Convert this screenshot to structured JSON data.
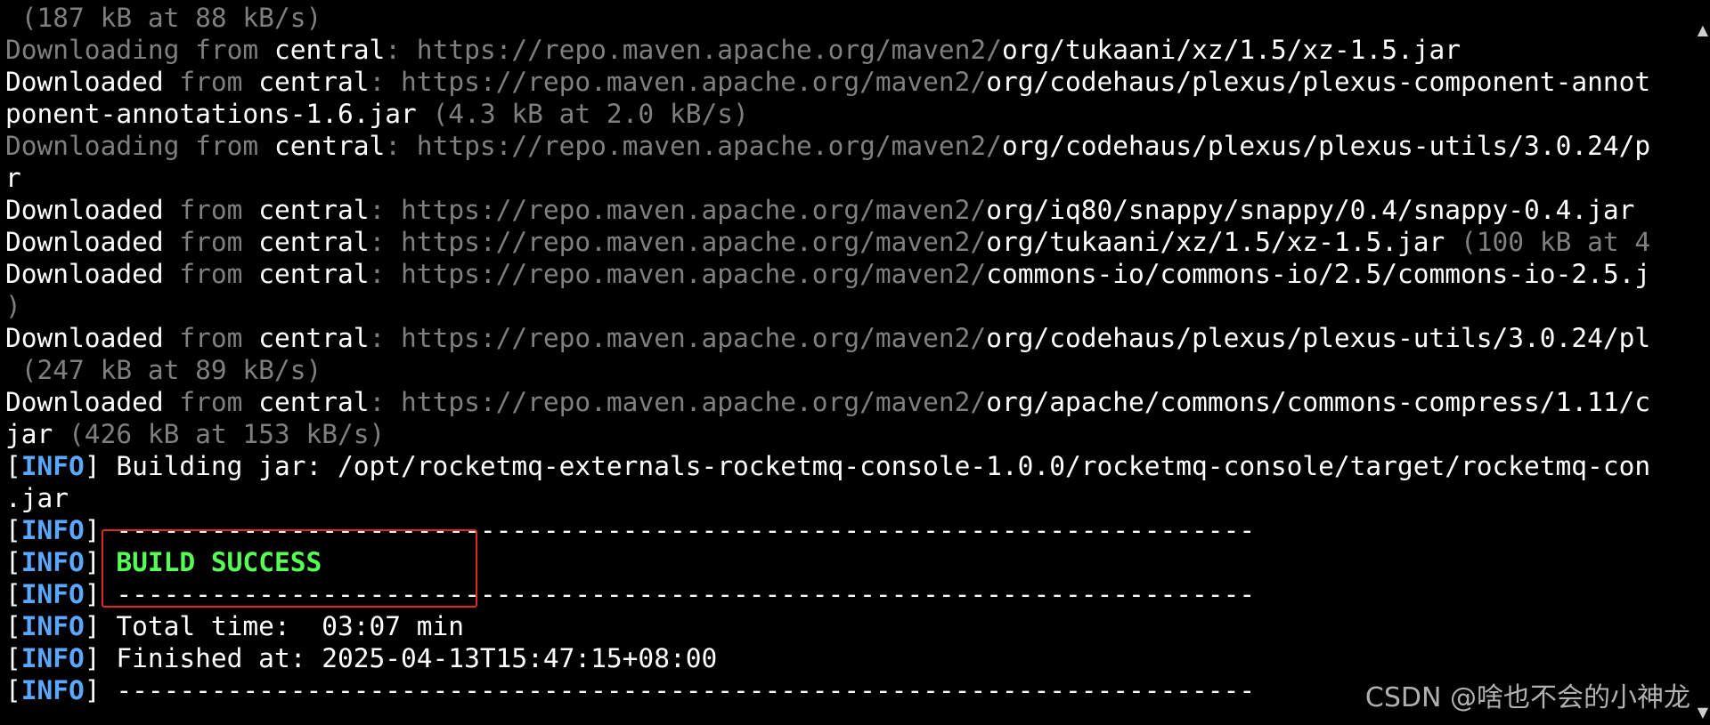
{
  "terminal": {
    "lines": [
      {
        "id": "l01",
        "parts": [
          {
            "t": " (187 kB at 88 kB/s)",
            "c": "dim"
          }
        ]
      },
      {
        "id": "l02",
        "parts": [
          {
            "t": "Downloading ",
            "c": "dim"
          },
          {
            "t": "from ",
            "c": "dim"
          },
          {
            "t": "central",
            "c": "bright"
          },
          {
            "t": ": https://repo.maven.apache.org/maven2/",
            "c": "dim"
          },
          {
            "t": "org/tukaani/xz/1.5/xz-1.5.jar",
            "c": "bright"
          }
        ]
      },
      {
        "id": "l03",
        "parts": [
          {
            "t": "Downloaded ",
            "c": "bright"
          },
          {
            "t": "from ",
            "c": "dim"
          },
          {
            "t": "central",
            "c": "bright"
          },
          {
            "t": ": https://repo.maven.apache.org/maven2/",
            "c": "dim"
          },
          {
            "t": "org/codehaus/plexus/plexus-component-annot",
            "c": "bright"
          }
        ]
      },
      {
        "id": "l04",
        "parts": [
          {
            "t": "ponent-annotations-1.6.jar ",
            "c": "bright"
          },
          {
            "t": "(4.3 kB at 2.0 kB/s)",
            "c": "dim"
          }
        ]
      },
      {
        "id": "l05",
        "parts": [
          {
            "t": "Downloading ",
            "c": "dim"
          },
          {
            "t": "from ",
            "c": "dim"
          },
          {
            "t": "central",
            "c": "bright"
          },
          {
            "t": ": https://repo.maven.apache.org/maven2/",
            "c": "dim"
          },
          {
            "t": "org/codehaus/plexus/plexus-utils/3.0.24/p",
            "c": "bright"
          }
        ]
      },
      {
        "id": "l06",
        "parts": [
          {
            "t": "r",
            "c": "bright"
          }
        ]
      },
      {
        "id": "l07",
        "parts": [
          {
            "t": "Downloaded ",
            "c": "bright"
          },
          {
            "t": "from ",
            "c": "dim"
          },
          {
            "t": "central",
            "c": "bright"
          },
          {
            "t": ": https://repo.maven.apache.org/maven2/",
            "c": "dim"
          },
          {
            "t": "org/iq80/snappy/snappy/0.4/snappy-0.4.jar",
            "c": "bright"
          }
        ]
      },
      {
        "id": "l08",
        "parts": [
          {
            "t": "Downloaded ",
            "c": "bright"
          },
          {
            "t": "from ",
            "c": "dim"
          },
          {
            "t": "central",
            "c": "bright"
          },
          {
            "t": ": https://repo.maven.apache.org/maven2/",
            "c": "dim"
          },
          {
            "t": "org/tukaani/xz/1.5/xz-1.5.jar ",
            "c": "bright"
          },
          {
            "t": "(100 kB at 4",
            "c": "dim"
          }
        ]
      },
      {
        "id": "l09",
        "parts": [
          {
            "t": "Downloaded ",
            "c": "bright"
          },
          {
            "t": "from ",
            "c": "dim"
          },
          {
            "t": "central",
            "c": "bright"
          },
          {
            "t": ": https://repo.maven.apache.org/maven2/",
            "c": "dim"
          },
          {
            "t": "commons-io/commons-io/2.5/commons-io-2.5.j",
            "c": "bright"
          }
        ]
      },
      {
        "id": "l10",
        "parts": [
          {
            "t": ")",
            "c": "dim"
          }
        ]
      },
      {
        "id": "l11",
        "parts": [
          {
            "t": "Downloaded ",
            "c": "bright"
          },
          {
            "t": "from ",
            "c": "dim"
          },
          {
            "t": "central",
            "c": "bright"
          },
          {
            "t": ": https://repo.maven.apache.org/maven2/",
            "c": "dim"
          },
          {
            "t": "org/codehaus/plexus/plexus-utils/3.0.24/pl",
            "c": "bright"
          }
        ]
      },
      {
        "id": "l12",
        "parts": [
          {
            "t": " (247 kB at 89 kB/s)",
            "c": "dim"
          }
        ]
      },
      {
        "id": "l13",
        "parts": [
          {
            "t": "Downloaded ",
            "c": "bright"
          },
          {
            "t": "from ",
            "c": "dim"
          },
          {
            "t": "central",
            "c": "bright"
          },
          {
            "t": ": https://repo.maven.apache.org/maven2/",
            "c": "dim"
          },
          {
            "t": "org/apache/commons/commons-compress/1.11/c",
            "c": "bright"
          }
        ]
      },
      {
        "id": "l14",
        "parts": [
          {
            "t": "jar ",
            "c": "bright"
          },
          {
            "t": "(426 kB at 153 kB/s)",
            "c": "dim"
          }
        ]
      },
      {
        "id": "l15",
        "parts": [
          {
            "t": "[",
            "c": "bright"
          },
          {
            "t": "INFO",
            "c": "info"
          },
          {
            "t": "] Building jar: /opt/rocketmq-externals-rocketmq-console-1.0.0/rocketmq-console/target/rocketmq-con",
            "c": "bright"
          }
        ]
      },
      {
        "id": "l16",
        "parts": [
          {
            "t": ".jar",
            "c": "bright"
          }
        ]
      },
      {
        "id": "l17",
        "parts": [
          {
            "t": "[",
            "c": "bright"
          },
          {
            "t": "INFO",
            "c": "info"
          },
          {
            "t": "] ------------------------------------------------------------------------",
            "c": "bright"
          }
        ]
      },
      {
        "id": "l18",
        "parts": [
          {
            "t": "[",
            "c": "bright"
          },
          {
            "t": "INFO",
            "c": "info"
          },
          {
            "t": "] ",
            "c": "bright"
          },
          {
            "t": "BUILD SUCCESS",
            "c": "success"
          }
        ]
      },
      {
        "id": "l19",
        "parts": [
          {
            "t": "[",
            "c": "bright"
          },
          {
            "t": "INFO",
            "c": "info"
          },
          {
            "t": "] ------------------------------------------------------------------------",
            "c": "bright"
          }
        ]
      },
      {
        "id": "l20",
        "parts": [
          {
            "t": "[",
            "c": "bright"
          },
          {
            "t": "INFO",
            "c": "info"
          },
          {
            "t": "] Total time:  03:07 min",
            "c": "bright"
          }
        ]
      },
      {
        "id": "l21",
        "parts": [
          {
            "t": "[",
            "c": "bright"
          },
          {
            "t": "INFO",
            "c": "info"
          },
          {
            "t": "] Finished at: 2025-04-13T15:47:15+08:00",
            "c": "bright"
          }
        ]
      },
      {
        "id": "l22",
        "parts": [
          {
            "t": "[",
            "c": "bright"
          },
          {
            "t": "INFO",
            "c": "info"
          },
          {
            "t": "] ------------------------------------------------------------------------",
            "c": "bright"
          }
        ]
      }
    ]
  },
  "watermark": {
    "text": "CSDN @啥也不会的小神龙"
  },
  "scrollbar": {
    "up_glyph": "▲",
    "down_glyph": "▼"
  },
  "colors": {
    "background": "#000000",
    "text": "#ffffff",
    "dim_text": "#7f7f7f",
    "info_tag": "#5aa8ff",
    "success": "#55ff55",
    "highlight_border": "#e02a20"
  }
}
